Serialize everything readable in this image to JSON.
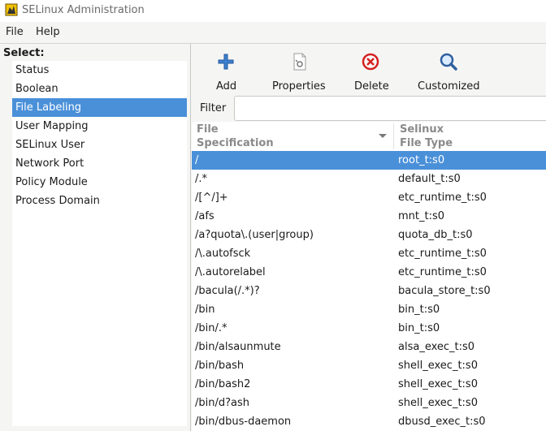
{
  "window": {
    "title": "SELinux Administration",
    "icon": "selinux-app-icon"
  },
  "menu": {
    "items": [
      "File",
      "Help"
    ]
  },
  "sidebar": {
    "label": "Select:",
    "items": [
      "Status",
      "Boolean",
      "File Labeling",
      "User Mapping",
      "SELinux User",
      "Network Port",
      "Policy Module",
      "Process Domain"
    ],
    "selected": "File Labeling"
  },
  "toolbar": {
    "add": "Add",
    "properties": "Properties",
    "delete": "Delete",
    "customized": "Customized"
  },
  "filter": {
    "label": "Filter",
    "value": ""
  },
  "table": {
    "columns": [
      {
        "line1": "File",
        "line2": "Specification"
      },
      {
        "line1": "Selinux",
        "line2": "File Type"
      }
    ],
    "rows": [
      [
        "/",
        "root_t:s0"
      ],
      [
        "/.*",
        "default_t:s0"
      ],
      [
        "/[^/]+",
        "etc_runtime_t:s0"
      ],
      [
        "/afs",
        "mnt_t:s0"
      ],
      [
        "/a?quota\\.(user|group)",
        "quota_db_t:s0"
      ],
      [
        "/\\.autofsck",
        "etc_runtime_t:s0"
      ],
      [
        "/\\.autorelabel",
        "etc_runtime_t:s0"
      ],
      [
        "/bacula(/.*)?",
        "bacula_store_t:s0"
      ],
      [
        "/bin",
        "bin_t:s0"
      ],
      [
        "/bin/.*",
        "bin_t:s0"
      ],
      [
        "/bin/alsaunmute",
        "alsa_exec_t:s0"
      ],
      [
        "/bin/bash",
        "shell_exec_t:s0"
      ],
      [
        "/bin/bash2",
        "shell_exec_t:s0"
      ],
      [
        "/bin/d?ash",
        "shell_exec_t:s0"
      ],
      [
        "/bin/dbus-daemon",
        "dbusd_exec_t:s0"
      ]
    ],
    "selected_row": 0
  },
  "colors": {
    "selection": "#4a90d9",
    "background": "#f5f5f4"
  }
}
